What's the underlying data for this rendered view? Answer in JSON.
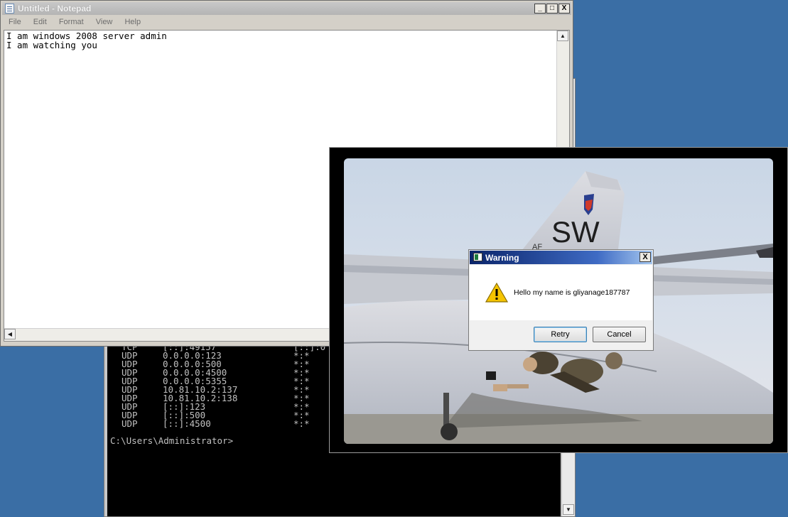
{
  "notepad": {
    "title": "Untitled - Notepad",
    "menu": [
      "File",
      "Edit",
      "Format",
      "View",
      "Help"
    ],
    "text": "I am windows 2008 server admin\nI am watching you",
    "buttons": {
      "minimize": "_",
      "maximize": "□",
      "close": "X"
    }
  },
  "console": {
    "rows": [
      {
        "proto": "TCP",
        "local": "[::]:49157",
        "foreign": "[::]:0"
      },
      {
        "proto": "UDP",
        "local": "0.0.0.0:123",
        "foreign": "*:*"
      },
      {
        "proto": "UDP",
        "local": "0.0.0.0:500",
        "foreign": "*:*"
      },
      {
        "proto": "UDP",
        "local": "0.0.0.0:4500",
        "foreign": "*:*"
      },
      {
        "proto": "UDP",
        "local": "0.0.0.0:5355",
        "foreign": "*:*"
      },
      {
        "proto": "UDP",
        "local": "10.81.10.2:137",
        "foreign": "*:*"
      },
      {
        "proto": "UDP",
        "local": "10.81.10.2:138",
        "foreign": "*:*"
      },
      {
        "proto": "UDP",
        "local": "[::]:123",
        "foreign": "*:*"
      },
      {
        "proto": "UDP",
        "local": "[::]:500",
        "foreign": "*:*"
      },
      {
        "proto": "UDP",
        "local": "[::]:4500",
        "foreign": "*:*"
      }
    ],
    "prompt": "C:\\Users\\Administrator>"
  },
  "photo": {
    "tail_text": "SW",
    "tail_small_text": "AF"
  },
  "dialog": {
    "title": "Warning",
    "message": "Hello my name is gliyanage187787",
    "retry_label": "Retry",
    "cancel_label": "Cancel",
    "close_label": "X",
    "icon": "warning-icon"
  },
  "colors": {
    "desktop": "#3a6ea5",
    "dialog_title": "#0a246a"
  }
}
